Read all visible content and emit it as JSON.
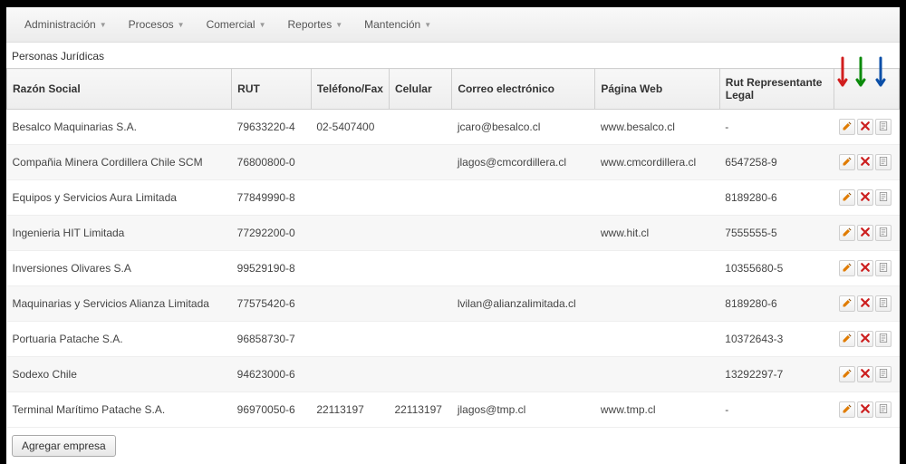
{
  "menu": {
    "items": [
      {
        "label": "Administración"
      },
      {
        "label": "Procesos"
      },
      {
        "label": "Comercial"
      },
      {
        "label": "Reportes"
      },
      {
        "label": "Mantención"
      }
    ]
  },
  "page_title": "Personas Jurídicas",
  "table": {
    "headers": {
      "razon": "Razón Social",
      "rut": "RUT",
      "telfax": "Teléfono/Fax",
      "cel": "Celular",
      "correo": "Correo electrónico",
      "web": "Página Web",
      "replegal": "Rut Representante Legal"
    },
    "rows": [
      {
        "razon": "Besalco Maquinarias S.A.",
        "rut": "79633220-4",
        "telfax": "02-5407400",
        "cel": "",
        "correo": "jcaro@besalco.cl",
        "web": "www.besalco.cl",
        "replegal": "-"
      },
      {
        "razon": "Compañia Minera Cordillera Chile SCM",
        "rut": "76800800-0",
        "telfax": "",
        "cel": "",
        "correo": "jlagos@cmcordillera.cl",
        "web": "www.cmcordillera.cl",
        "replegal": "6547258-9"
      },
      {
        "razon": "Equipos y Servicios Aura Limitada",
        "rut": "77849990-8",
        "telfax": "",
        "cel": "",
        "correo": "",
        "web": "",
        "replegal": "8189280-6"
      },
      {
        "razon": "Ingenieria HIT Limitada",
        "rut": "77292200-0",
        "telfax": "",
        "cel": "",
        "correo": "",
        "web": "www.hit.cl",
        "replegal": "7555555-5"
      },
      {
        "razon": "Inversiones Olivares S.A",
        "rut": "99529190-8",
        "telfax": "",
        "cel": "",
        "correo": "",
        "web": "",
        "replegal": "10355680-5"
      },
      {
        "razon": "Maquinarias y Servicios Alianza Limitada",
        "rut": "77575420-6",
        "telfax": "",
        "cel": "",
        "correo": "lvilan@alianzalimitada.cl",
        "web": "",
        "replegal": "8189280-6"
      },
      {
        "razon": "Portuaria Patache S.A.",
        "rut": "96858730-7",
        "telfax": "",
        "cel": "",
        "correo": "",
        "web": "",
        "replegal": "10372643-3"
      },
      {
        "razon": "Sodexo Chile",
        "rut": "94623000-6",
        "telfax": "",
        "cel": "",
        "correo": "",
        "web": "",
        "replegal": "13292297-7"
      },
      {
        "razon": "Terminal Marítimo Patache S.A.",
        "rut": "96970050-6",
        "telfax": "22113197",
        "cel": "22113197",
        "correo": "jlagos@tmp.cl",
        "web": "www.tmp.cl",
        "replegal": "-"
      }
    ]
  },
  "buttons": {
    "add": "Agregar empresa"
  },
  "icons": {
    "edit": "edit-icon",
    "delete": "delete-icon",
    "detail": "detail-icon"
  },
  "annotation_arrows": [
    {
      "color": "#d11e1e"
    },
    {
      "color": "#0b8a0b"
    },
    {
      "color": "#0b4fa8"
    }
  ]
}
